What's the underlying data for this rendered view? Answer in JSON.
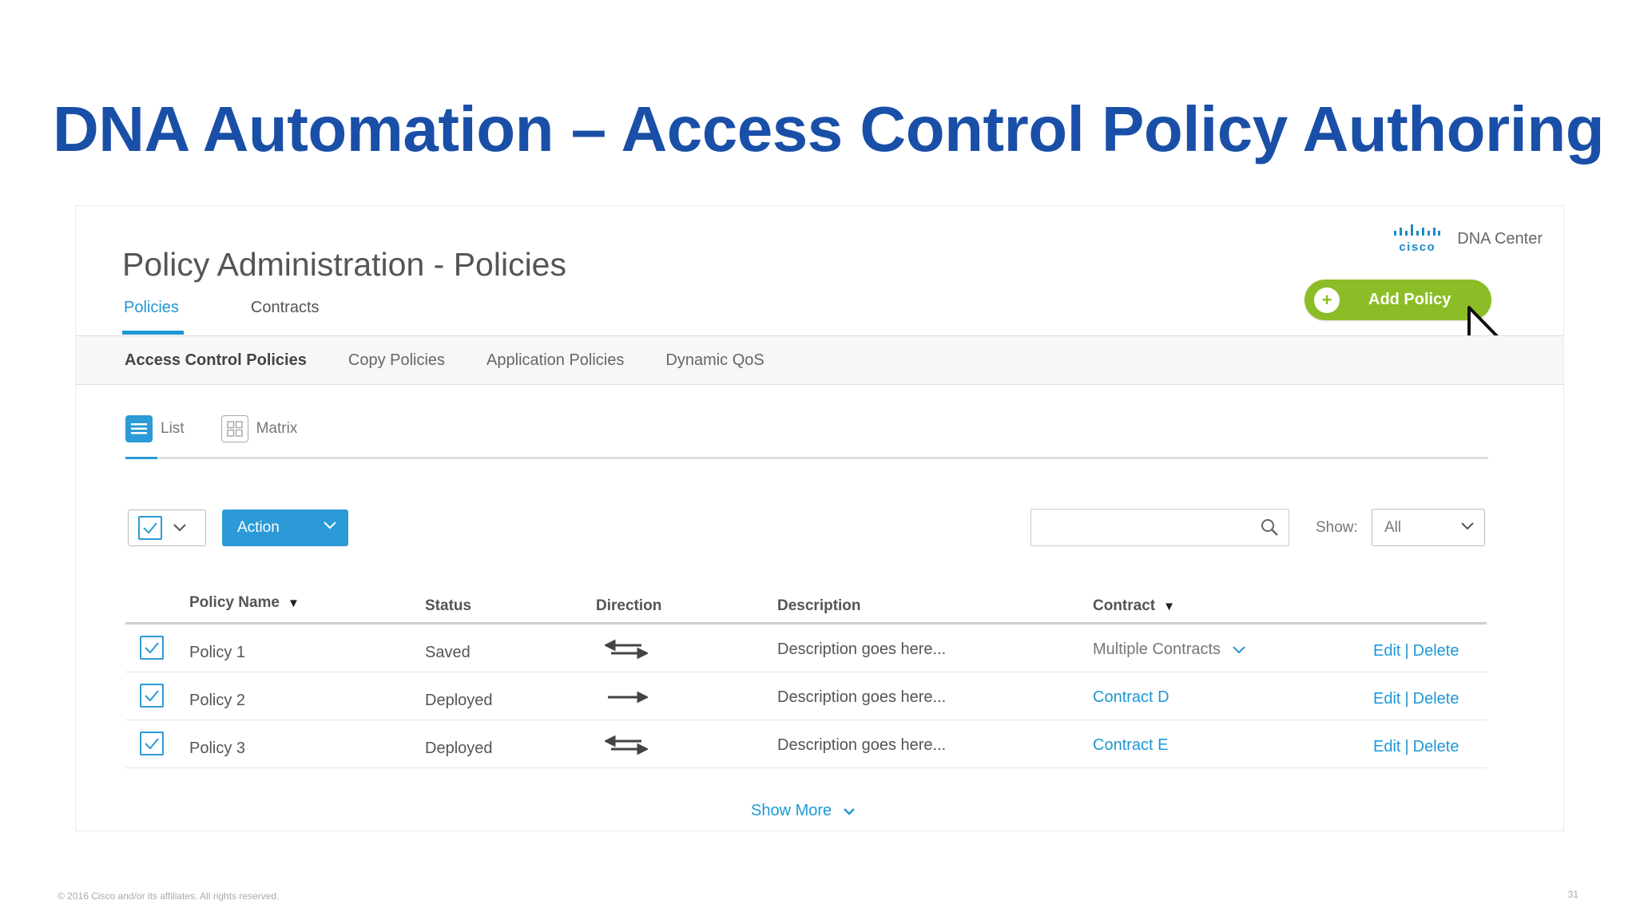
{
  "slide": {
    "title": "DNA Automation – Access Control Policy Authoring",
    "footer_copyright": "© 2016 Cisco and/or its affiliates. All rights reserved.",
    "page_number": "31"
  },
  "app": {
    "brand_logo": "cisco",
    "brand_name": "DNA Center",
    "page_title": "Policy Administration - Policies",
    "top_tabs": [
      {
        "label": "Policies",
        "active": true
      },
      {
        "label": "Contracts",
        "active": false
      }
    ],
    "add_button_label": "Add Policy",
    "sub_nav": [
      {
        "label": "Access Control Policies",
        "active": true
      },
      {
        "label": "Copy Policies",
        "active": false
      },
      {
        "label": "Application Policies",
        "active": false
      },
      {
        "label": "Dynamic QoS",
        "active": false
      }
    ],
    "view_toggle": {
      "list_label": "List",
      "matrix_label": "Matrix",
      "selected": "List"
    },
    "toolbar": {
      "action_label": "Action",
      "search_value": "",
      "show_label": "Show:",
      "show_value": "All"
    },
    "table": {
      "headers": {
        "policy_name": "Policy Name",
        "status": "Status",
        "direction": "Direction",
        "description": "Description",
        "contract": "Contract"
      },
      "rows": [
        {
          "checked": true,
          "name": "Policy 1",
          "status": "Saved",
          "direction": "bidirectional",
          "description": "Description goes here...",
          "contract": "Multiple Contracts",
          "contract_is_dropdown": true,
          "edit_label": "Edit",
          "delete_label": "Delete"
        },
        {
          "checked": true,
          "name": "Policy 2",
          "status": "Deployed",
          "direction": "unidirectional",
          "description": "Description goes here...",
          "contract": "Contract D",
          "contract_is_dropdown": false,
          "edit_label": "Edit",
          "delete_label": "Delete"
        },
        {
          "checked": true,
          "name": "Policy 3",
          "status": "Deployed",
          "direction": "bidirectional",
          "description": "Description goes here...",
          "contract": "Contract E",
          "contract_is_dropdown": false,
          "edit_label": "Edit",
          "delete_label": "Delete"
        }
      ]
    },
    "show_more_label": "Show More",
    "colors": {
      "accent_blue": "#1f97d4",
      "add_green": "#8cbd26",
      "title_blue": "#1a4fa8"
    }
  }
}
